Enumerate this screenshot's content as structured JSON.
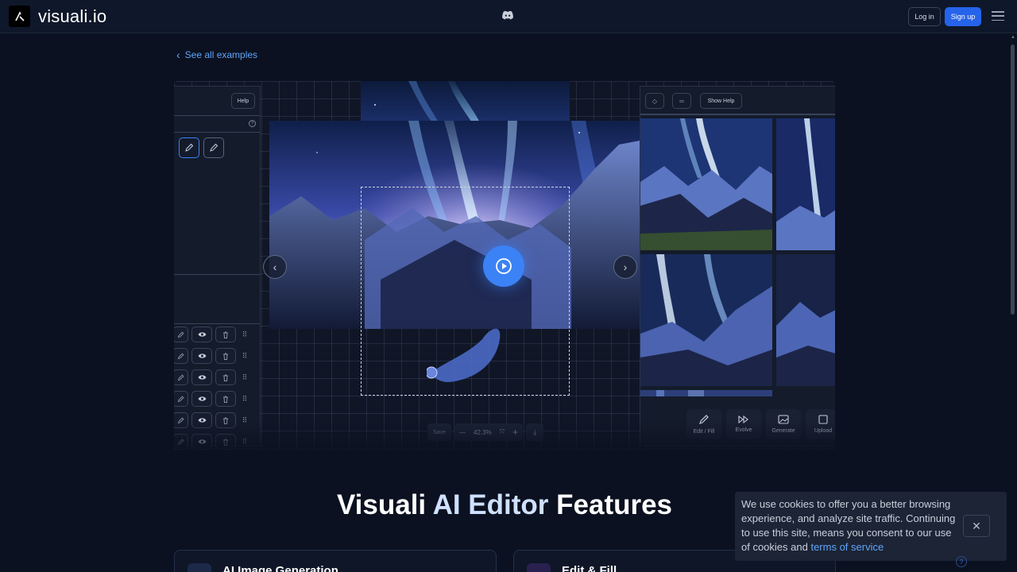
{
  "header": {
    "brand": "visuali.io",
    "login_label": "Log in",
    "signup_label": "Sign up"
  },
  "back_link": {
    "label": "See all examples"
  },
  "editor": {
    "left_panel": {
      "help_label": "Help"
    },
    "right_panel": {
      "show_help_label": "Show Help",
      "tools": [
        {
          "label": "Edit / Fill",
          "icon": "brush-icon"
        },
        {
          "label": "Evolve",
          "icon": "fast-forward-icon"
        },
        {
          "label": "Generate",
          "icon": "image-icon"
        },
        {
          "label": "Upload",
          "icon": "upload-icon"
        }
      ]
    },
    "bottom_toolbar": {
      "save_label": "Save",
      "zoom_level": "42.3%"
    }
  },
  "features": {
    "title_part1": "Visuali ",
    "title_highlight": "AI Editor",
    "title_part2": " Features",
    "cards": [
      {
        "title": "AI Image Generation"
      },
      {
        "title": "Edit & Fill"
      }
    ]
  },
  "cookie_banner": {
    "text": "We use cookies to offer you a better browsing experience, and analyze site traffic. Continuing to use this site, means you consent to our use of cookies and ",
    "link_label": "terms of service"
  },
  "colors": {
    "background": "#0b1120",
    "accent": "#2563eb",
    "link": "#60a5fa"
  }
}
